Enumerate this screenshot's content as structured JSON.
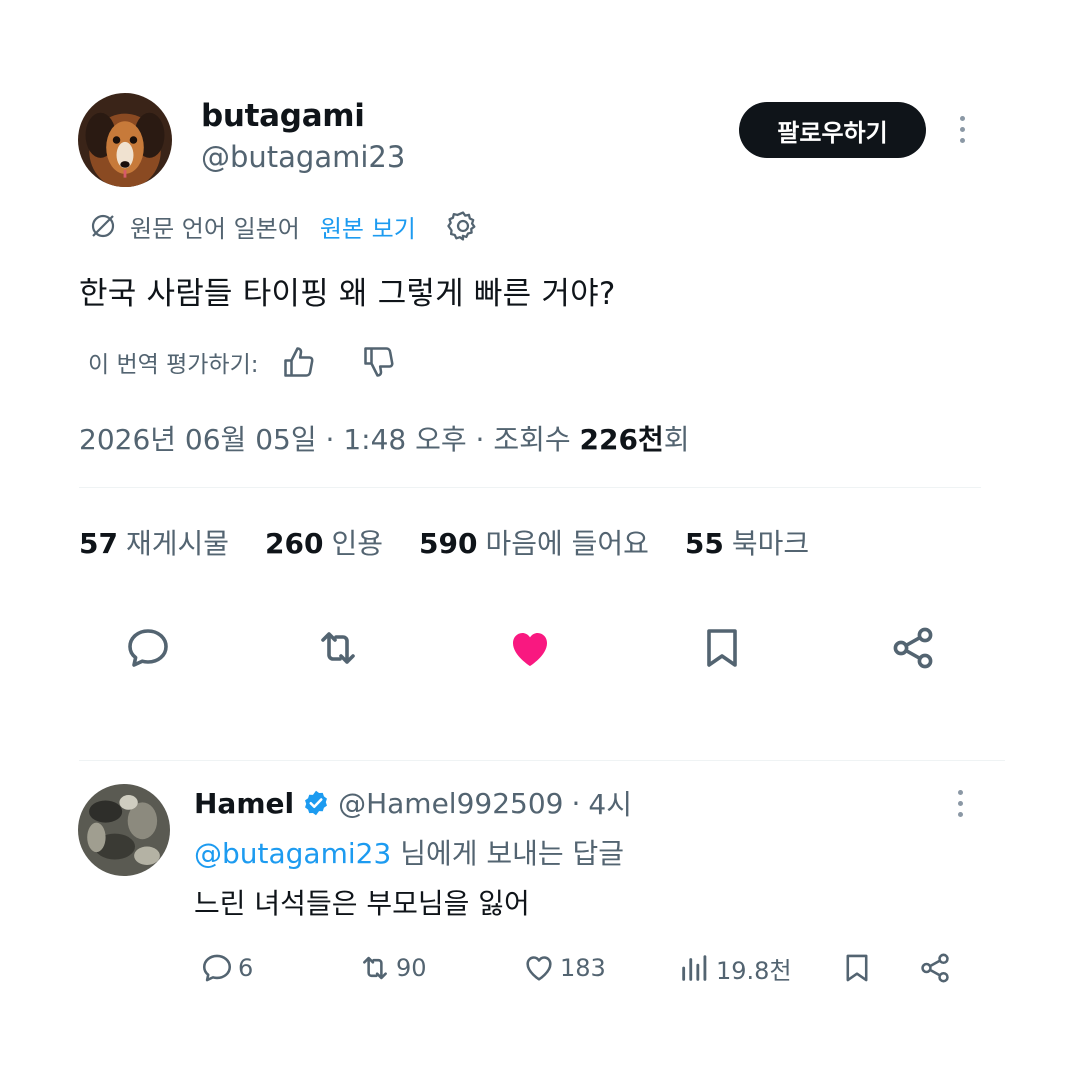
{
  "tweet": {
    "author": {
      "display_name": "butagami",
      "handle": "@butagami23"
    },
    "follow_label": "팔로우하기",
    "translation": {
      "source_label": "원문 언어 일본어",
      "show_original_label": "원본 보기"
    },
    "text": "한국 사람들 타이핑 왜 그렇게 빠른 거야?",
    "rate_label": "이 번역 평가하기:",
    "meta": {
      "date": "2026년 06월 05일",
      "time": "1:48 오후",
      "views_prefix": "조회수",
      "views_count": "226천",
      "views_suffix": "회"
    },
    "stats": [
      {
        "count": "57",
        "label": "재게시물"
      },
      {
        "count": "260",
        "label": "인용"
      },
      {
        "count": "590",
        "label": "마음에 들어요"
      },
      {
        "count": "55",
        "label": "북마크"
      }
    ],
    "liked": true
  },
  "reply": {
    "display_name": "Hamel",
    "handle": "@Hamel992509",
    "time": "4시",
    "replying_to_handle": "@butagami23",
    "replying_to_suffix": "님에게 보내는 답글",
    "text": "느린 녀석들은 부모님을 잃어",
    "actions": {
      "replies": "6",
      "retweets": "90",
      "likes": "183",
      "views": "19.8천"
    }
  },
  "colors": {
    "accent": "#1d9bf0",
    "like": "#f91880",
    "text": "#0f1419",
    "muted": "#536471"
  }
}
